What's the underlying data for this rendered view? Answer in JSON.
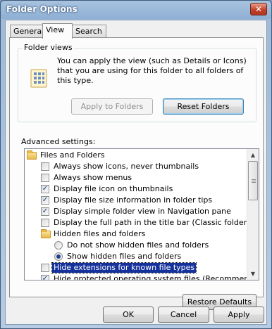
{
  "window": {
    "title": "Folder Options",
    "close_glyph": "✕"
  },
  "tabs": [
    {
      "label": "General",
      "active": false
    },
    {
      "label": "View",
      "active": true
    },
    {
      "label": "Search",
      "active": false
    }
  ],
  "folder_views": {
    "label": "Folder views",
    "description": "You can apply the view (such as Details or Icons) that you are using for this folder to all folders of this type.",
    "apply_button": "Apply to Folders",
    "reset_button": "Reset Folders",
    "icon": "folder-views-icon"
  },
  "advanced": {
    "label": "Advanced settings:",
    "items": [
      {
        "type": "folder",
        "label": "Files and Folders"
      },
      {
        "type": "checkbox",
        "label": "Always show icons, never thumbnails",
        "checked": false
      },
      {
        "type": "checkbox",
        "label": "Always show menus",
        "checked": false
      },
      {
        "type": "checkbox",
        "label": "Display file icon on thumbnails",
        "checked": true
      },
      {
        "type": "checkbox",
        "label": "Display file size information in folder tips",
        "checked": true
      },
      {
        "type": "checkbox",
        "label": "Display simple folder view in Navigation pane",
        "checked": true
      },
      {
        "type": "checkbox",
        "label": "Display the full path in the title bar (Classic folders only)",
        "checked": false
      },
      {
        "type": "folder",
        "label": "Hidden files and folders"
      },
      {
        "type": "radio",
        "label": "Do not show hidden files and folders",
        "checked": false
      },
      {
        "type": "radio",
        "label": "Show hidden files and folders",
        "checked": true
      },
      {
        "type": "checkbox",
        "label": "Hide extensions for known file types",
        "checked": false,
        "selected": true
      },
      {
        "type": "checkbox",
        "label": "Hide protected operating system files (Recommended)",
        "checked": true
      }
    ]
  },
  "restore_button": "Restore Defaults",
  "footer": {
    "ok": "OK",
    "cancel": "Cancel",
    "apply": "Apply"
  },
  "colors": {
    "selection": "#15329c",
    "accent": "#3c7fb1"
  }
}
